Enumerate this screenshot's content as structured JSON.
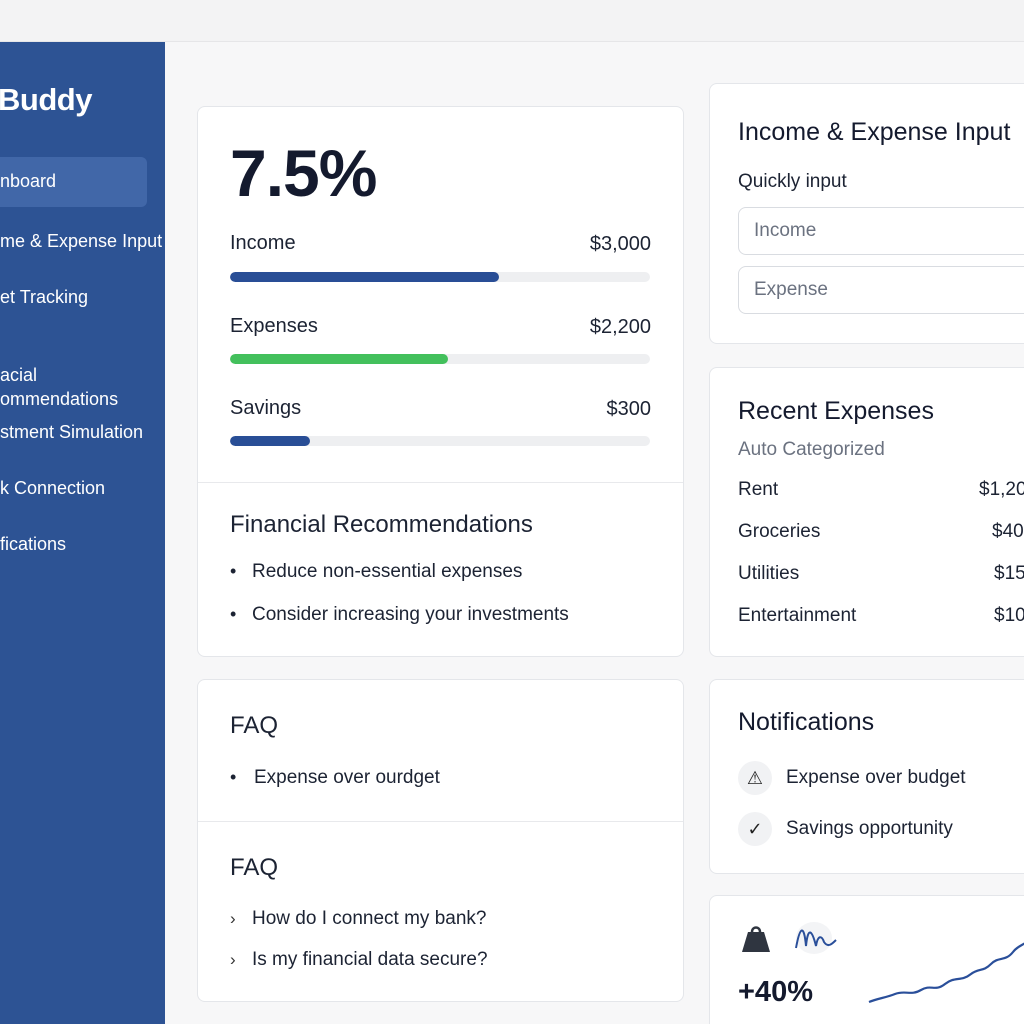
{
  "app": {
    "brand": "Buddy"
  },
  "sidebar": {
    "items": [
      {
        "label": "nboard",
        "active": true
      },
      {
        "label": "me & Expense Input"
      },
      {
        "label": "et Tracking"
      },
      {
        "label": "acial\nommendations"
      },
      {
        "label": "stment Simulation"
      },
      {
        "label": "k Connection"
      },
      {
        "label": "fications"
      }
    ]
  },
  "summary": {
    "rate": "7.5%",
    "bars": [
      {
        "label": "Income",
        "amount": "$3,000",
        "progress": 0.64,
        "color": "#294e96"
      },
      {
        "label": "Expenses",
        "amount": "$2,200",
        "progress": 0.52,
        "color": "#43c05c"
      },
      {
        "label": "Savings",
        "amount": "$300",
        "progress": 0.19,
        "color": "#294e96"
      }
    ]
  },
  "recommendations": {
    "title": "Financial Recommendations",
    "items": [
      "Reduce non-essential expenses",
      "Consider increasing your investments"
    ]
  },
  "faq1": {
    "title": "FAQ",
    "items": [
      "Expense over ourdget"
    ]
  },
  "faq2": {
    "title": "FAQ",
    "items": [
      "How do I connect my bank?",
      "Is my financial data secure?"
    ]
  },
  "input_panel": {
    "title": "Income & Expense Input",
    "subtitle": "Quickly input",
    "income_placeholder": "Income",
    "expense_placeholder": "Expense"
  },
  "recent_expenses": {
    "title": "Recent Expenses",
    "subtitle": "Auto Categorized",
    "rows": [
      {
        "name": "Rent",
        "amount": "$1,20"
      },
      {
        "name": "Groceries",
        "amount": "$40"
      },
      {
        "name": "Utilities",
        "amount": "$15"
      },
      {
        "name": "Entertainment",
        "amount": "$10"
      }
    ]
  },
  "notifications": {
    "title": "Notifications",
    "items": [
      {
        "icon": "warning-icon",
        "glyph": "⚠",
        "text": "Expense over budget"
      },
      {
        "icon": "check-icon",
        "glyph": "✓",
        "text": "Savings opportunity"
      }
    ]
  },
  "growth": {
    "value": "+40%",
    "accent": "#2a4f9a"
  }
}
